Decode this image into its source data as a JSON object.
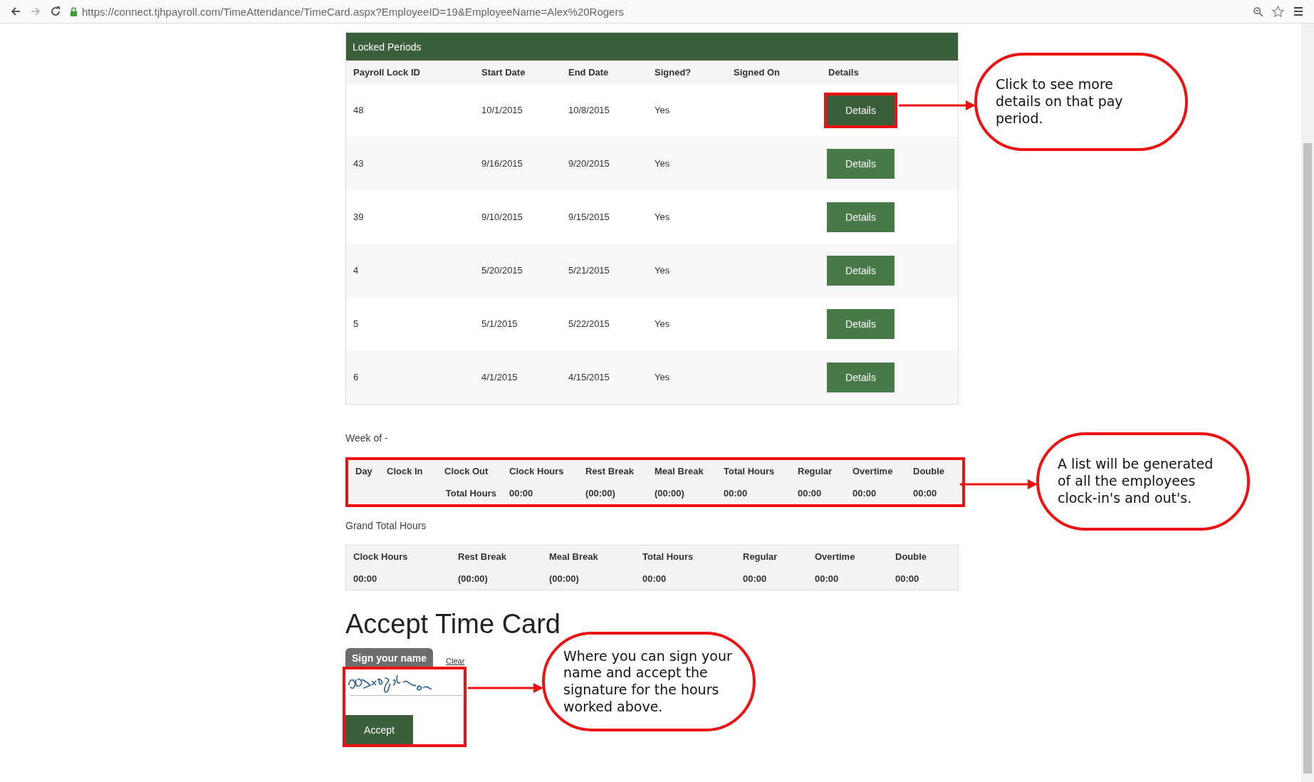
{
  "browser": {
    "url": "https://connect.tjhpayroll.com/TimeAttendance/TimeCard.aspx?EmployeeID=19&EmployeeName=Alex%20Rogers"
  },
  "locked_periods": {
    "title": "Locked Periods",
    "columns": [
      "Payroll Lock ID",
      "Start Date",
      "End Date",
      "Signed?",
      "Signed On",
      "Details"
    ],
    "rows": [
      {
        "id": "48",
        "start": "10/1/2015",
        "end": "10/8/2015",
        "signed": "Yes",
        "button": "Details",
        "highlighted": true
      },
      {
        "id": "43",
        "start": "9/16/2015",
        "end": "9/20/2015",
        "signed": "Yes",
        "button": "Details",
        "highlighted": false
      },
      {
        "id": "39",
        "start": "9/10/2015",
        "end": "9/15/2015",
        "signed": "Yes",
        "button": "Details",
        "highlighted": false
      },
      {
        "id": "4",
        "start": "5/20/2015",
        "end": "5/21/2015",
        "signed": "Yes",
        "button": "Details",
        "highlighted": false
      },
      {
        "id": "5",
        "start": "5/1/2015",
        "end": "5/22/2015",
        "signed": "Yes",
        "button": "Details",
        "highlighted": false
      },
      {
        "id": "6",
        "start": "4/1/2015",
        "end": "4/15/2015",
        "signed": "Yes",
        "button": "Details",
        "highlighted": false
      }
    ]
  },
  "week": {
    "label": "Week of -",
    "highlighted": true,
    "columns": [
      "Day",
      "Clock In",
      "Clock Out",
      "Clock Hours",
      "Rest Break",
      "Meal Break",
      "Total Hours",
      "Regular",
      "Overtime",
      "Double"
    ],
    "total_label": "Total Hours",
    "totals": [
      "00:00",
      "(00:00)",
      "(00:00)",
      "00:00",
      "00:00",
      "00:00",
      "00:00"
    ]
  },
  "grand_total": {
    "label": "Grand Total Hours",
    "columns": [
      "Clock Hours",
      "Rest Break",
      "Meal Break",
      "Total Hours",
      "Regular",
      "Overtime",
      "Double"
    ],
    "values": [
      "00:00",
      "(00:00)",
      "(00:00)",
      "00:00",
      "00:00",
      "00:00",
      "00:00"
    ]
  },
  "accept": {
    "title": "Accept Time Card",
    "sign_tab": "Sign your name",
    "clear_link": "Clear",
    "highlighted": true,
    "button": "Accept"
  },
  "callouts": [
    {
      "text": "Click to see more details on that pay period."
    },
    {
      "text": "A list will be generated of all the employees clock-in's and out's."
    },
    {
      "text": "Where you can sign your name and accept the signature for the hours worked above."
    }
  ]
}
